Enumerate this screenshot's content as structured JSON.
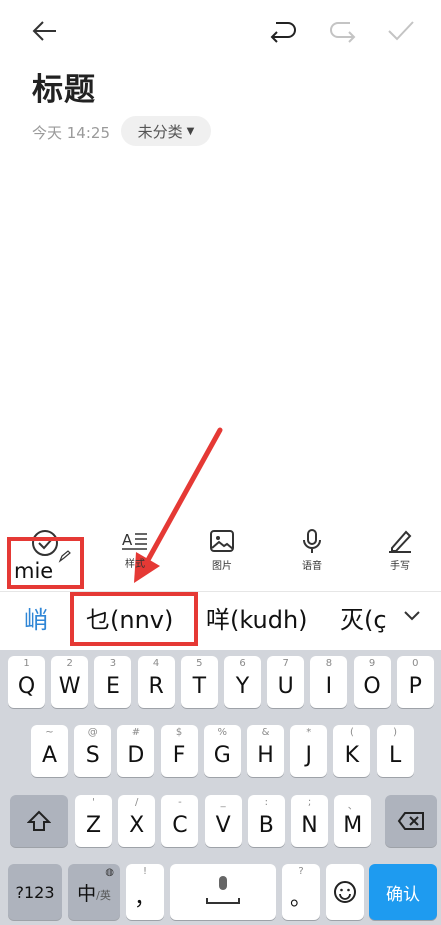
{
  "note": {
    "title": "标题",
    "date": "今天 14:25",
    "category": "未分类"
  },
  "toolbar": {
    "composing_text": "mie",
    "items": [
      {
        "label": "样式",
        "icon": "text-style-icon"
      },
      {
        "label": "图片",
        "icon": "image-icon"
      },
      {
        "label": "语音",
        "icon": "microphone-icon"
      },
      {
        "label": "手写",
        "icon": "pen-icon"
      }
    ]
  },
  "candidates": [
    "峭",
    "乜(nnv)",
    "咩(kudh)",
    "灭(ç"
  ],
  "keyboard": {
    "row1": [
      {
        "k": "Q",
        "s": "1"
      },
      {
        "k": "W",
        "s": "2"
      },
      {
        "k": "E",
        "s": "3"
      },
      {
        "k": "R",
        "s": "4"
      },
      {
        "k": "T",
        "s": "5"
      },
      {
        "k": "Y",
        "s": "6"
      },
      {
        "k": "U",
        "s": "7"
      },
      {
        "k": "I",
        "s": "8"
      },
      {
        "k": "O",
        "s": "9"
      },
      {
        "k": "P",
        "s": "0"
      }
    ],
    "row2": [
      {
        "k": "A",
        "s": "~"
      },
      {
        "k": "S",
        "s": "@"
      },
      {
        "k": "D",
        "s": "#"
      },
      {
        "k": "F",
        "s": "$"
      },
      {
        "k": "G",
        "s": "%"
      },
      {
        "k": "H",
        "s": "&"
      },
      {
        "k": "J",
        "s": "*"
      },
      {
        "k": "K",
        "s": "("
      },
      {
        "k": "L",
        "s": ")"
      }
    ],
    "row3": [
      {
        "k": "Z",
        "s": "'"
      },
      {
        "k": "X",
        "s": "/"
      },
      {
        "k": "C",
        "s": "-"
      },
      {
        "k": "V",
        "s": "_"
      },
      {
        "k": "B",
        "s": ":"
      },
      {
        "k": "N",
        "s": ";"
      },
      {
        "k": "M",
        "s": "、"
      }
    ],
    "sym_label": "?123",
    "lang_main": "中",
    "lang_sub": "/英",
    "comma_sup": "!",
    "comma": "，",
    "period_sup": "?",
    "period": "。",
    "confirm": "确认"
  },
  "colors": {
    "accent": "#2f86d6",
    "highlight": "#e53935",
    "confirm": "#1e9bf0"
  }
}
